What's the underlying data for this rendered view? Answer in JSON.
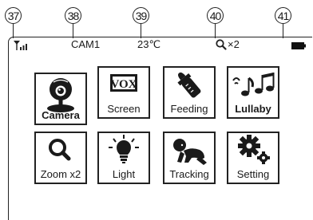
{
  "callouts": [
    "37",
    "38",
    "39",
    "40",
    "41"
  ],
  "status_bar": {
    "camera": "CAM1",
    "temperature": "23℃",
    "zoom": "×2",
    "icons": [
      "signal-icon",
      "magnifier-icon",
      "battery-icon"
    ]
  },
  "menu": [
    {
      "label": "Camera",
      "icon": "camera-icon",
      "selected": true
    },
    {
      "label": "Screen",
      "icon": "vox-screen-icon",
      "selected": false
    },
    {
      "label": "Feeding",
      "icon": "baby-bottle-icon",
      "selected": false
    },
    {
      "label": "Lullaby",
      "icon": "music-notes-icon",
      "selected": false
    },
    {
      "label": "Zoom x2",
      "icon": "magnifier-icon",
      "selected": false
    },
    {
      "label": "Light",
      "icon": "light-bulb-icon",
      "selected": false
    },
    {
      "label": "Tracking",
      "icon": "crawling-baby-icon",
      "selected": false
    },
    {
      "label": "Setting",
      "icon": "gears-icon",
      "selected": false
    }
  ],
  "screen_icon_text": "VOX"
}
